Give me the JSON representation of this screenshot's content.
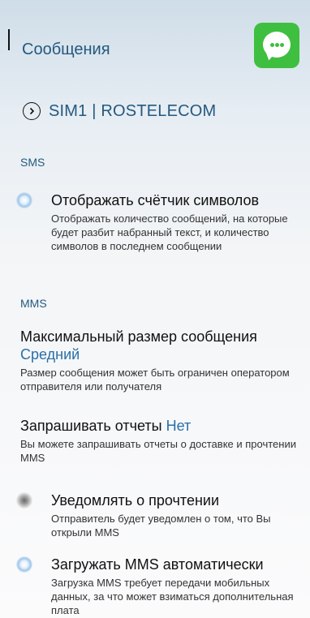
{
  "header": {
    "title": "Сообщения",
    "app_icon": "messages-app-icon"
  },
  "sim": {
    "label": "SIM1 | ROSTELECOM",
    "icon": "chevron-right-circle-icon"
  },
  "sections": {
    "sms": "SMS",
    "mms": "MMS"
  },
  "char_counter": {
    "title": "Отображать счётчик символов",
    "description": "Отображать количество сообщений, на которые будет разбит набранный текст, и количество символов в последнем сообщении",
    "enabled": true
  },
  "max_size": {
    "title": "Максимальный размер сообщения",
    "value": "Средний",
    "description": "Размер сообщения может быть ограничен оператором отправителя или получателя"
  },
  "request_reports": {
    "title": "Запрашивать отчеты",
    "value": "Нет",
    "description": "Вы можете запрашивать отчеты о доставке и прочтении MMS"
  },
  "read_notify": {
    "title": "Уведомлять о прочтении",
    "description": "Отправитель будет уведомлен о том, что Вы открыли MMS",
    "enabled": false
  },
  "auto_mms": {
    "title": "Загружать MMS автоматически",
    "description": "Загрузка MMS требует передачи мобильных данных, за что может взиматься дополнительная плата",
    "enabled": true
  }
}
